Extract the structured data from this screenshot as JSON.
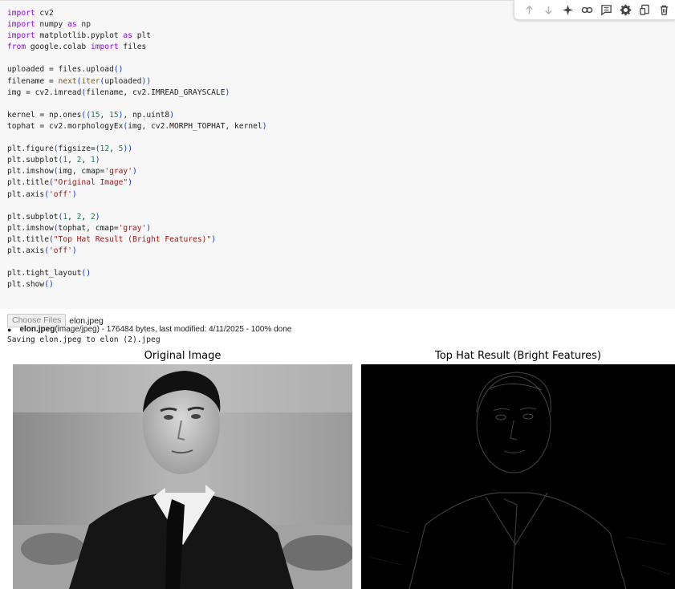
{
  "code_lines": [
    [
      {
        "t": "import",
        "c": "kw"
      },
      {
        "t": " cv2",
        "c": ""
      }
    ],
    [
      {
        "t": "import",
        "c": "kw"
      },
      {
        "t": " numpy ",
        "c": ""
      },
      {
        "t": "as",
        "c": "kw"
      },
      {
        "t": " np",
        "c": ""
      }
    ],
    [
      {
        "t": "import",
        "c": "kw"
      },
      {
        "t": " matplotlib.pyplot ",
        "c": ""
      },
      {
        "t": "as",
        "c": "kw"
      },
      {
        "t": " plt",
        "c": ""
      }
    ],
    [
      {
        "t": "from",
        "c": "kw"
      },
      {
        "t": " google.colab ",
        "c": ""
      },
      {
        "t": "import",
        "c": "kw"
      },
      {
        "t": " files",
        "c": ""
      }
    ],
    [],
    [
      {
        "t": "uploaded = files.upload",
        "c": ""
      },
      {
        "t": "()",
        "c": "par"
      }
    ],
    [
      {
        "t": "filename = ",
        "c": ""
      },
      {
        "t": "next",
        "c": "fn"
      },
      {
        "t": "(",
        "c": "par"
      },
      {
        "t": "iter",
        "c": "fn"
      },
      {
        "t": "(",
        "c": "par"
      },
      {
        "t": "uploaded",
        "c": ""
      },
      {
        "t": "))",
        "c": "par"
      }
    ],
    [
      {
        "t": "img = cv2.imread",
        "c": ""
      },
      {
        "t": "(",
        "c": "par"
      },
      {
        "t": "filename, cv2.IMREAD_GRAYSCALE",
        "c": ""
      },
      {
        "t": ")",
        "c": "par"
      }
    ],
    [],
    [
      {
        "t": "kernel = np.ones",
        "c": ""
      },
      {
        "t": "((",
        "c": "par"
      },
      {
        "t": "15",
        "c": "num"
      },
      {
        "t": ", ",
        "c": ""
      },
      {
        "t": "15",
        "c": "num"
      },
      {
        "t": ")",
        "c": "par"
      },
      {
        "t": ", np.uint8",
        "c": ""
      },
      {
        "t": ")",
        "c": "par"
      }
    ],
    [
      {
        "t": "tophat = cv2.morphologyEx",
        "c": ""
      },
      {
        "t": "(",
        "c": "par"
      },
      {
        "t": "img, cv2.MORPH_TOPHAT, kernel",
        "c": ""
      },
      {
        "t": ")",
        "c": "par"
      }
    ],
    [],
    [
      {
        "t": "plt.figure",
        "c": ""
      },
      {
        "t": "(",
        "c": "par"
      },
      {
        "t": "figsize=",
        "c": ""
      },
      {
        "t": "(",
        "c": "par"
      },
      {
        "t": "12",
        "c": "num"
      },
      {
        "t": ", ",
        "c": ""
      },
      {
        "t": "5",
        "c": "num"
      },
      {
        "t": "))",
        "c": "par"
      }
    ],
    [
      {
        "t": "plt.subplot",
        "c": ""
      },
      {
        "t": "(",
        "c": "par"
      },
      {
        "t": "1",
        "c": "num"
      },
      {
        "t": ", ",
        "c": ""
      },
      {
        "t": "2",
        "c": "num"
      },
      {
        "t": ", ",
        "c": ""
      },
      {
        "t": "1",
        "c": "num"
      },
      {
        "t": ")",
        "c": "par"
      }
    ],
    [
      {
        "t": "plt.imshow",
        "c": ""
      },
      {
        "t": "(",
        "c": "par"
      },
      {
        "t": "img, cmap=",
        "c": ""
      },
      {
        "t": "'gray'",
        "c": "str"
      },
      {
        "t": ")",
        "c": "par"
      }
    ],
    [
      {
        "t": "plt.title",
        "c": ""
      },
      {
        "t": "(",
        "c": "par"
      },
      {
        "t": "\"Original Image\"",
        "c": "str"
      },
      {
        "t": ")",
        "c": "par"
      }
    ],
    [
      {
        "t": "plt.axis",
        "c": ""
      },
      {
        "t": "(",
        "c": "par"
      },
      {
        "t": "'off'",
        "c": "str"
      },
      {
        "t": ")",
        "c": "par"
      }
    ],
    [],
    [
      {
        "t": "plt.subplot",
        "c": ""
      },
      {
        "t": "(",
        "c": "par"
      },
      {
        "t": "1",
        "c": "num"
      },
      {
        "t": ", ",
        "c": ""
      },
      {
        "t": "2",
        "c": "num"
      },
      {
        "t": ", ",
        "c": ""
      },
      {
        "t": "2",
        "c": "num"
      },
      {
        "t": ")",
        "c": "par"
      }
    ],
    [
      {
        "t": "plt.imshow",
        "c": ""
      },
      {
        "t": "(",
        "c": "par"
      },
      {
        "t": "tophat, cmap=",
        "c": ""
      },
      {
        "t": "'gray'",
        "c": "str"
      },
      {
        "t": ")",
        "c": "par"
      }
    ],
    [
      {
        "t": "plt.title",
        "c": ""
      },
      {
        "t": "(",
        "c": "par"
      },
      {
        "t": "\"Top Hat Result (Bright Features)\"",
        "c": "str"
      },
      {
        "t": ")",
        "c": "par"
      }
    ],
    [
      {
        "t": "plt.axis",
        "c": ""
      },
      {
        "t": "(",
        "c": "par"
      },
      {
        "t": "'off'",
        "c": "str"
      },
      {
        "t": ")",
        "c": "par"
      }
    ],
    [],
    [
      {
        "t": "plt.tight_layout",
        "c": ""
      },
      {
        "t": "()",
        "c": "par"
      }
    ],
    [
      {
        "t": "plt.show",
        "c": ""
      },
      {
        "t": "()",
        "c": "par"
      }
    ]
  ],
  "toolbar": {
    "icons": [
      "arrow-up-icon",
      "arrow-down-icon",
      "sparkle-icon",
      "link-icon",
      "comment-icon",
      "gear-icon",
      "mirror-cell-icon",
      "trash-icon"
    ]
  },
  "output": {
    "choose_files_label": "Choose Files",
    "chosen_file": "elon.jpeg",
    "file_name": "elon.jpeg",
    "file_details": "(image/jpeg) - 176484 bytes, last modified: 4/11/2025 - 100% done",
    "saving_text": "Saving elon.jpeg to elon (2).jpeg"
  },
  "figure": {
    "left_title": "Original Image",
    "right_title": "Top Hat Result (Bright Features)"
  }
}
